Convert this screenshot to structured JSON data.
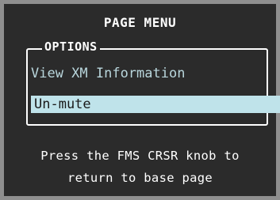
{
  "menu": {
    "title": "PAGE MENU",
    "group_label": "OPTIONS",
    "items": [
      {
        "label": "View XM Information",
        "selected": false
      },
      {
        "label": "Un-mute",
        "selected": true
      }
    ]
  },
  "hint": {
    "line1": "Press the FMS CRSR knob to",
    "line2": "return to base page"
  },
  "colors": {
    "background": "#2b2b2b",
    "bezel": "#8f8f8f",
    "highlight": "#bfe3ea",
    "text": "#ffffff",
    "item_text": "#b9d6dc"
  }
}
